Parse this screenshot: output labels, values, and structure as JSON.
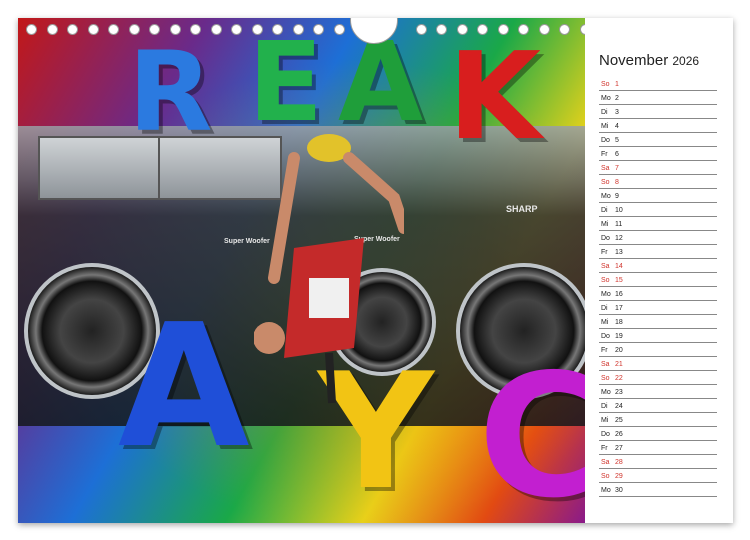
{
  "calendar": {
    "month": "November",
    "year": "2026",
    "days": [
      {
        "wd": "So",
        "d": "1",
        "we": true
      },
      {
        "wd": "Mo",
        "d": "2",
        "we": false
      },
      {
        "wd": "Di",
        "d": "3",
        "we": false
      },
      {
        "wd": "Mi",
        "d": "4",
        "we": false
      },
      {
        "wd": "Do",
        "d": "5",
        "we": false
      },
      {
        "wd": "Fr",
        "d": "6",
        "we": false
      },
      {
        "wd": "Sa",
        "d": "7",
        "we": true
      },
      {
        "wd": "So",
        "d": "8",
        "we": true
      },
      {
        "wd": "Mo",
        "d": "9",
        "we": false
      },
      {
        "wd": "Di",
        "d": "10",
        "we": false
      },
      {
        "wd": "Mi",
        "d": "11",
        "we": false
      },
      {
        "wd": "Do",
        "d": "12",
        "we": false
      },
      {
        "wd": "Fr",
        "d": "13",
        "we": false
      },
      {
        "wd": "Sa",
        "d": "14",
        "we": true
      },
      {
        "wd": "So",
        "d": "15",
        "we": true
      },
      {
        "wd": "Mo",
        "d": "16",
        "we": false
      },
      {
        "wd": "Di",
        "d": "17",
        "we": false
      },
      {
        "wd": "Mi",
        "d": "18",
        "we": false
      },
      {
        "wd": "Do",
        "d": "19",
        "we": false
      },
      {
        "wd": "Fr",
        "d": "20",
        "we": false
      },
      {
        "wd": "Sa",
        "d": "21",
        "we": true
      },
      {
        "wd": "So",
        "d": "22",
        "we": true
      },
      {
        "wd": "Mo",
        "d": "23",
        "we": false
      },
      {
        "wd": "Di",
        "d": "24",
        "we": false
      },
      {
        "wd": "Mi",
        "d": "25",
        "we": false
      },
      {
        "wd": "Do",
        "d": "26",
        "we": false
      },
      {
        "wd": "Fr",
        "d": "27",
        "we": false
      },
      {
        "wd": "Sa",
        "d": "28",
        "we": true
      },
      {
        "wd": "So",
        "d": "29",
        "we": true
      },
      {
        "wd": "Mo",
        "d": "30",
        "we": false
      }
    ]
  },
  "photo": {
    "letters": [
      "R",
      "E",
      "A",
      "K",
      "A",
      "Y",
      "C"
    ],
    "brand_text": "SHARP",
    "speaker_label": "Super Woofer",
    "colors": {
      "weekend": "#d0342c",
      "text": "#222222"
    }
  }
}
